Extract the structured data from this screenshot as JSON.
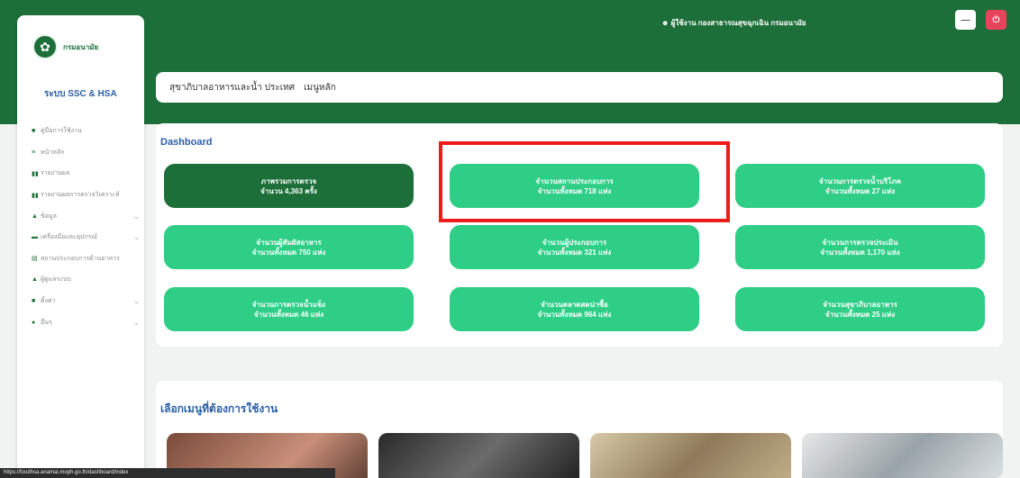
{
  "header": {
    "user_info": "ผู้ใช้งาน กองสาธารณสุขฉุกเฉิน กรมอนามัย",
    "minimize_label": "—",
    "close_label": "⏻"
  },
  "sidebar": {
    "logo_text": "กรมอนามัย",
    "system_name": "ระบบ SSC & HSA",
    "items": [
      {
        "icon": "■",
        "label": "คู่มือการใช้งาน",
        "chevron": ""
      },
      {
        "icon": "≡",
        "label": "หน้าหลัก",
        "chevron": ""
      },
      {
        "icon": "▮▮",
        "label": "รายงานผล",
        "chevron": ""
      },
      {
        "icon": "▮▮",
        "label": "รายงานผลการตรวจวิเคราะห์",
        "chevron": ""
      },
      {
        "icon": "▲",
        "label": "ข้อมูล",
        "chevron": "⌄"
      },
      {
        "icon": "▬",
        "label": "เครื่องมือและอุปกรณ์",
        "chevron": "⌄"
      },
      {
        "icon": "▤",
        "label": "สถานประกอบการด้านอาหาร",
        "chevron": ""
      },
      {
        "icon": "▲",
        "label": "ผู้ดูแลระบบ",
        "chevron": ""
      },
      {
        "icon": "■",
        "label": "ตั้งค่า",
        "chevron": "⌄"
      },
      {
        "icon": "●",
        "label": "อื่นๆ",
        "chevron": "⌄"
      }
    ]
  },
  "breadcrumb": {
    "path": "สุขาภิบาลอาหารและน้ำ ประเทศ",
    "current": "เมนูหลัก"
  },
  "dashboard": {
    "title": "Dashboard",
    "tiles": [
      {
        "line1": "ภาพรวมการตรวจ",
        "line2": "จำนวน 4,363 ครั้ง",
        "dark": true
      },
      {
        "line1": "จำนวนสถานประกอบการ",
        "line2": "จำนวนทั้งหมด 718 แห่ง",
        "dark": false
      },
      {
        "line1": "จำนวนการตรวจน้ำบริโภค",
        "line2": "จำนวนทั้งหมด 27 แห่ง",
        "dark": false
      },
      {
        "line1": "จำนวนผู้สัมผัสอาหาร",
        "line2": "จำนวนทั้งหมด 750 แห่ง",
        "dark": false
      },
      {
        "line1": "จำนวนผู้ประกอบการ",
        "line2": "จำนวนทั้งหมด 321 แห่ง",
        "dark": false
      },
      {
        "line1": "จำนวนการตรวจประเมิน",
        "line2": "จำนวนทั้งหมด 1,170 แห่ง",
        "dark": false
      },
      {
        "line1": "จำนวนการตรวจน้ำแข็ง",
        "line2": "จำนวนทั้งหมด 46 แห่ง",
        "dark": false
      },
      {
        "line1": "จำนวนตลาดสดน่าซื้อ",
        "line2": "จำนวนทั้งหมด 964 แห่ง",
        "dark": false
      },
      {
        "line1": "จำนวนสุขาภิบาลอาหาร",
        "line2": "จำนวนทั้งหมด 25 แห่ง",
        "dark": false
      }
    ]
  },
  "menu_section": {
    "title": "เลือกเมนูที่ต้องการใช้งาน"
  },
  "statusbar": {
    "text": "https://foodhsa.anamai.moph.go.th/dashboard/index"
  },
  "colors": {
    "header_green": "#1d6f3a",
    "tile_green": "#2fce86",
    "accent_blue": "#2b5fa5",
    "highlight_red": "#ee1b1b",
    "close_red": "#e8435c"
  }
}
